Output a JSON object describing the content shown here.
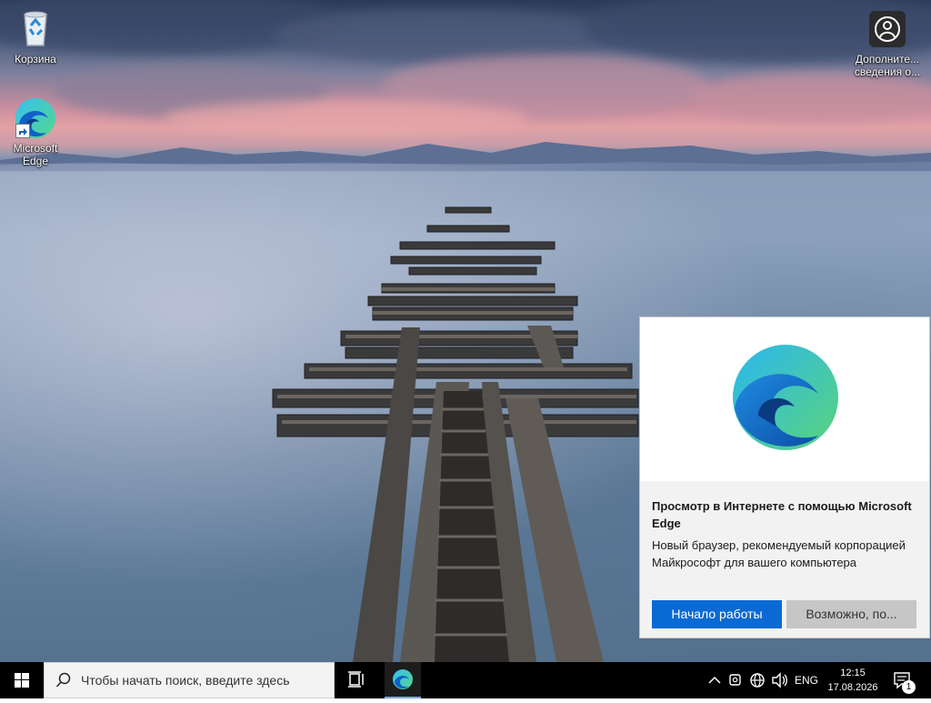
{
  "desktop": {
    "icons": [
      {
        "name": "recycle-bin",
        "label": "Корзина"
      },
      {
        "name": "microsoft-edge",
        "label": "Microsoft Edge"
      },
      {
        "name": "additional-info",
        "label": "Дополните... сведения о..."
      }
    ]
  },
  "toast": {
    "title": "Просмотр в Интернете с помощью Microsoft Edge",
    "body": "Новый браузер, рекомендуемый корпорацией Майкрософт для вашего компьютера",
    "primary_button": "Начало работы",
    "secondary_button": "Возможно, по..."
  },
  "taskbar": {
    "search_placeholder": "Чтобы начать поиск, введите здесь",
    "tray": {
      "language": "ENG",
      "time": "12:15",
      "date": "17.08.2026",
      "notification_count": "1"
    }
  },
  "colors": {
    "accent": "#0a6ad4",
    "taskbar": "#000000"
  }
}
